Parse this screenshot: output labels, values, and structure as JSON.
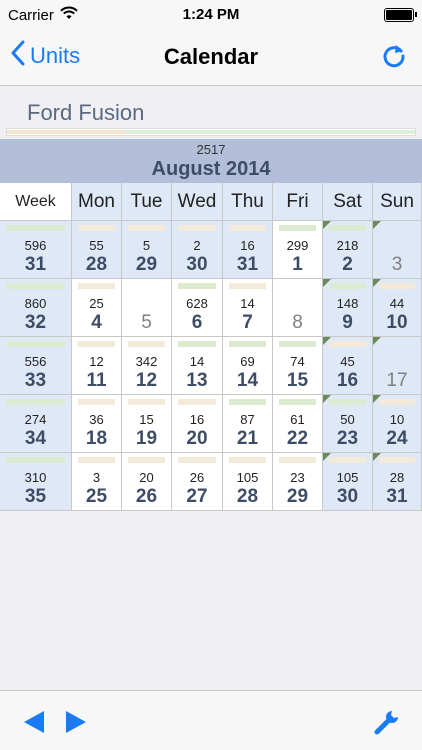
{
  "status": {
    "carrier": "Carrier",
    "time": "1:24 PM"
  },
  "nav": {
    "back_label": "Units",
    "title": "Calendar"
  },
  "vehicle": "Ford Fusion",
  "month_total": "2517",
  "month_title": "August 2014",
  "month_progress": 0.29,
  "headers": {
    "week": "Week",
    "days": [
      "Mon",
      "Tue",
      "Wed",
      "Thu",
      "Fri",
      "Sat",
      "Sun"
    ]
  },
  "weeks": [
    {
      "week": "31",
      "amount": "596",
      "days": [
        {
          "d": "28",
          "a": "55"
        },
        {
          "d": "29",
          "a": "5"
        },
        {
          "d": "30",
          "a": "2"
        },
        {
          "d": "31",
          "a": "16"
        },
        {
          "d": "1",
          "a": "299"
        },
        {
          "d": "2",
          "a": "218"
        },
        {
          "d": "3",
          "a": ""
        }
      ]
    },
    {
      "week": "32",
      "amount": "860",
      "days": [
        {
          "d": "4",
          "a": "25"
        },
        {
          "d": "5",
          "a": ""
        },
        {
          "d": "6",
          "a": "628"
        },
        {
          "d": "7",
          "a": "14"
        },
        {
          "d": "8",
          "a": ""
        },
        {
          "d": "9",
          "a": "148"
        },
        {
          "d": "10",
          "a": "44"
        }
      ]
    },
    {
      "week": "33",
      "amount": "556",
      "days": [
        {
          "d": "11",
          "a": "12"
        },
        {
          "d": "12",
          "a": "342"
        },
        {
          "d": "13",
          "a": "14"
        },
        {
          "d": "14",
          "a": "69"
        },
        {
          "d": "15",
          "a": "74"
        },
        {
          "d": "16",
          "a": "45"
        },
        {
          "d": "17",
          "a": ""
        }
      ]
    },
    {
      "week": "34",
      "amount": "274",
      "days": [
        {
          "d": "18",
          "a": "36"
        },
        {
          "d": "19",
          "a": "15"
        },
        {
          "d": "20",
          "a": "16"
        },
        {
          "d": "21",
          "a": "87"
        },
        {
          "d": "22",
          "a": "61"
        },
        {
          "d": "23",
          "a": "50"
        },
        {
          "d": "24",
          "a": "10"
        }
      ]
    },
    {
      "week": "35",
      "amount": "310",
      "days": [
        {
          "d": "25",
          "a": "3"
        },
        {
          "d": "26",
          "a": "20"
        },
        {
          "d": "27",
          "a": "26"
        },
        {
          "d": "28",
          "a": "105"
        },
        {
          "d": "29",
          "a": "23"
        },
        {
          "d": "30",
          "a": "105"
        },
        {
          "d": "31",
          "a": "28"
        }
      ]
    }
  ],
  "icons": {
    "back": "chevron-left-icon",
    "refresh": "refresh-icon",
    "prev": "triangle-left-icon",
    "next": "triangle-right-icon",
    "tools": "wrench-icon",
    "wifi": "wifi-icon",
    "battery": "battery-icon"
  },
  "colors": {
    "accent": "#1a7cf5",
    "header_bg": "#b3bfd9",
    "weekend_bg": "#dfe8f7",
    "day_num": "#3e4d66"
  }
}
